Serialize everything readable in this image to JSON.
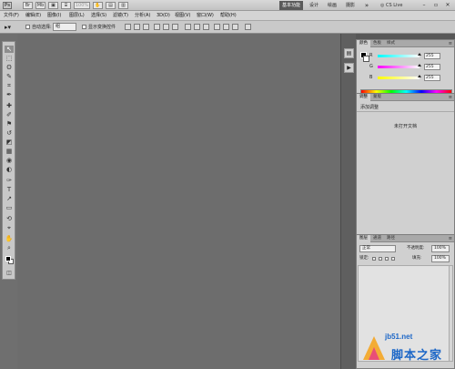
{
  "app": {
    "logo": "Ps",
    "cslive_label": "CS Live",
    "workspaces": [
      "基本功能",
      "设计",
      "绘画",
      "摄影"
    ],
    "more_label": "»",
    "window_controls": [
      "minimize-icon",
      "maximize-icon",
      "close-icon"
    ]
  },
  "title_buttons": [
    {
      "label": "Br"
    },
    {
      "label": "Mb"
    },
    {
      "label": "▣"
    },
    {
      "label": "⌸"
    },
    {
      "label": "100%"
    },
    {
      "label": "✋"
    },
    {
      "label": "▤"
    },
    {
      "label": "▥"
    }
  ],
  "menu": [
    "文件(F)",
    "编辑(E)",
    "图像(I)",
    "图层(L)",
    "选择(S)",
    "滤镜(T)",
    "分析(A)",
    "3D(D)",
    "视图(V)",
    "窗口(W)",
    "帮助(H)"
  ],
  "options": {
    "auto_select": "自动选择:",
    "auto_select_value": "组",
    "show_transform": "显示变换控件"
  },
  "tools": [
    "move-tool-icon",
    "marquee-tool-icon",
    "lasso-tool-icon",
    "quick-select-tool-icon",
    "crop-tool-icon",
    "eyedropper-tool-icon",
    "healing-tool-icon",
    "brush-tool-icon",
    "clone-stamp-tool-icon",
    "history-brush-tool-icon",
    "eraser-tool-icon",
    "gradient-tool-icon",
    "blur-tool-icon",
    "dodge-tool-icon",
    "pen-tool-icon",
    "type-tool-icon",
    "path-select-tool-icon",
    "shape-tool-icon",
    "3d-rotate-tool-icon",
    "3d-camera-tool-icon",
    "hand-tool-icon",
    "zoom-tool-icon"
  ],
  "tool_glyphs": [
    "↖",
    "⬚",
    "ʘ",
    "✎",
    "⌗",
    "✒",
    "✚",
    "✐",
    "⚑",
    "↺",
    "◩",
    "▦",
    "◉",
    "◐",
    "✑",
    "T",
    "↗",
    "▭",
    "⟲",
    "⌖",
    "✋",
    "⌕"
  ],
  "color_panel": {
    "tabs": [
      "颜色",
      "色板",
      "样式"
    ],
    "r_label": "R",
    "r_value": "255",
    "g_label": "G",
    "g_value": "255",
    "b_label": "B",
    "b_value": "255"
  },
  "adjust_panel": {
    "tabs": [
      "调整",
      "蒙版"
    ],
    "title": "添加调整",
    "empty": "未打开文档"
  },
  "layers_panel": {
    "tabs": [
      "图层",
      "通道",
      "路径"
    ],
    "blend_mode": "正常",
    "opacity_label": "不透明度:",
    "opacity_value": "100%",
    "lock_label": "锁定:",
    "fill_label": "填充:",
    "fill_value": "100%"
  },
  "watermark": {
    "url": "jb51.net",
    "text": "脚本之家"
  }
}
